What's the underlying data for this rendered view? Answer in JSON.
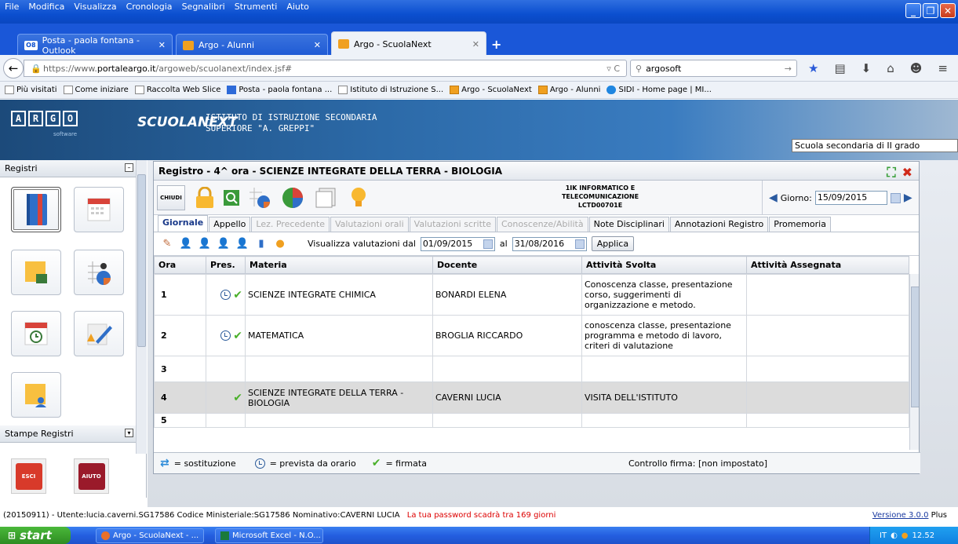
{
  "browser": {
    "menu": [
      "File",
      "Modifica",
      "Visualizza",
      "Cronologia",
      "Segnalibri",
      "Strumenti",
      "Aiuto"
    ],
    "tabs": [
      {
        "label": "Posta - paola fontana - Outlook",
        "icon": "outlook-icon",
        "badge": "O8"
      },
      {
        "label": "Argo - Alunni",
        "icon": "argo-icon"
      },
      {
        "label": "Argo - ScuolaNext",
        "icon": "argo-icon"
      }
    ],
    "url_prefix": "https://www.",
    "url_domain": "portaleargo.it",
    "url_path": "/argoweb/scuolanext/index.jsf#",
    "search_value": "argosoft",
    "bookmarks": [
      "Più visitati",
      "Come iniziare",
      "Raccolta Web Slice",
      "Posta - paola fontana ...",
      "Istituto di Istruzione S...",
      "Argo - ScuolaNext",
      "Argo - Alunni",
      "SIDI - Home page | MI..."
    ]
  },
  "app": {
    "logo_letters": [
      "A",
      "R",
      "G",
      "O"
    ],
    "logo_sub": "software",
    "product": "SCUOLANEXT",
    "school_line1": "ISTITUTO DI ISTRUZIONE SECONDARIA",
    "school_line2": "SUPERIORE \"A. GREPPI\"",
    "school_type": "Scuola secondaria di II grado"
  },
  "sidebar": {
    "section1": "Registri",
    "section2": "Stampe Registri",
    "esci": "ESCI",
    "aiuto": "AIUTO"
  },
  "register": {
    "title": "Registro - 4^ ora - SCIENZE INTEGRATE DELLA TERRA - BIOLOGIA",
    "chiudi": "CHIUDI",
    "class_line1": "1IK INFORMATICO E",
    "class_line2": "TELECOMUNICAZIONE",
    "class_line3": "LCTD00701E",
    "giorno_label": "Giorno:",
    "giorno_value": "15/09/2015",
    "tabs": [
      {
        "label": "Giornale",
        "state": "active"
      },
      {
        "label": "Appello",
        "state": "normal"
      },
      {
        "label": "Lez. Precedente",
        "state": "disabled"
      },
      {
        "label": "Valutazioni orali",
        "state": "disabled"
      },
      {
        "label": "Valutazioni scritte",
        "state": "disabled"
      },
      {
        "label": "Conoscenze/Abilità",
        "state": "disabled"
      },
      {
        "label": "Note Disciplinari",
        "state": "normal"
      },
      {
        "label": "Annotazioni Registro",
        "state": "normal"
      },
      {
        "label": "Promemoria",
        "state": "normal"
      }
    ],
    "val_label": "Visualizza valutazioni dal",
    "val_from": "01/09/2015",
    "val_al": "al",
    "val_to": "31/08/2016",
    "applica": "Applica",
    "columns": [
      "Ora",
      "Pres.",
      "Materia",
      "Docente",
      "Attività Svolta",
      "Attività Assegnata"
    ],
    "rows": [
      {
        "ora": "1",
        "clock": true,
        "check": true,
        "materia": "SCIENZE INTEGRATE CHIMICA",
        "docente": "BONARDI ELENA",
        "svolta": "Conoscenza classe, presentazione corso, suggerimenti di organizzazione e metodo.",
        "assegnata": ""
      },
      {
        "ora": "2",
        "clock": true,
        "check": true,
        "materia": "MATEMATICA",
        "docente": "BROGLIA RICCARDO",
        "svolta": "conoscenza classe, presentazione programma e metodo di lavoro, criteri di valutazione",
        "assegnata": ""
      },
      {
        "ora": "3",
        "clock": false,
        "check": false,
        "materia": "",
        "docente": "",
        "svolta": "",
        "assegnata": ""
      },
      {
        "ora": "4",
        "clock": false,
        "check": true,
        "materia": "SCIENZE INTEGRATE DELLA TERRA - BIOLOGIA",
        "docente": "CAVERNI LUCIA",
        "svolta": "VISITA DELL'ISTITUTO",
        "assegnata": ""
      },
      {
        "ora": "5",
        "clock": false,
        "check": false,
        "materia": "",
        "docente": "",
        "svolta": "",
        "assegnata": ""
      }
    ],
    "legend_sost": "= sostituzione",
    "legend_prev": "= prevista da orario",
    "legend_firm": "= firmata",
    "controllo": "Controllo firma: [non impostato]"
  },
  "status": {
    "info": "(20150911) - Utente:lucia.caverni.SG17586 Codice Ministeriale:SG17586 Nominativo:CAVERNI LUCIA",
    "warning": "La tua password scadrà tra 169 giorni",
    "version": "Versione 3.0.0",
    "plus": " Plus"
  },
  "taskbar": {
    "start": "start",
    "items": [
      "Argo - ScuolaNext - ...",
      "Microsoft Excel - N.O..."
    ],
    "lang": "IT",
    "time": "12.52"
  },
  "colors": {
    "accent": "#0b4fd0",
    "check": "#4ab02a",
    "warning": "#dd0000",
    "selected_row": "#dcdcdc"
  }
}
